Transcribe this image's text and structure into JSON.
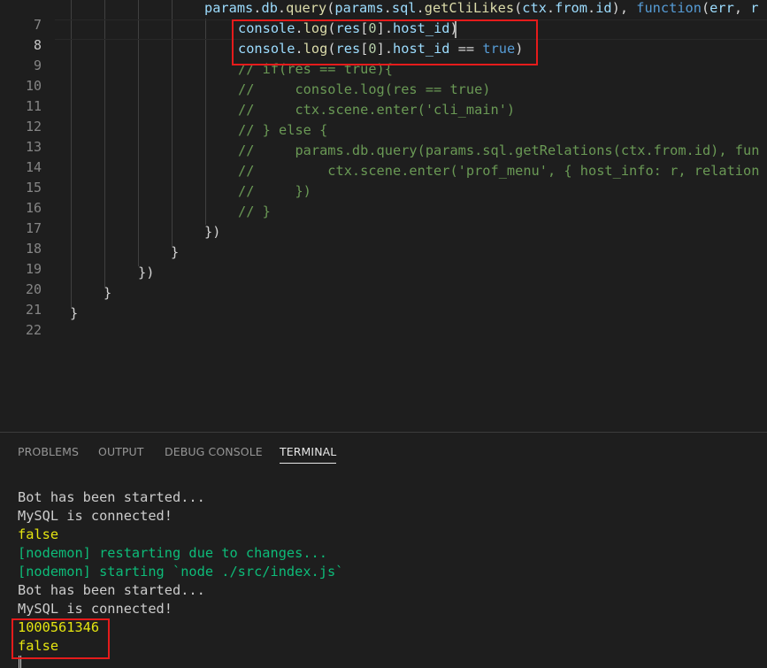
{
  "editor": {
    "lines": [
      {
        "num": "7",
        "text": "params.db.query(params.sql.getCliLikes(ctx.from.id), function(err, r"
      },
      {
        "num": "8",
        "text": "console.log(res[0].host_id)"
      },
      {
        "num": "9",
        "text": "console.log(res[0].host_id == true)"
      },
      {
        "num": "10",
        "text": "// if(res == true){"
      },
      {
        "num": "11",
        "text": "//     console.log(res == true)"
      },
      {
        "num": "12",
        "text": "//     ctx.scene.enter('cli_main')"
      },
      {
        "num": "13",
        "text": "// } else {"
      },
      {
        "num": "14",
        "text": "//     params.db.query(params.sql.getRelations(ctx.from.id), fun"
      },
      {
        "num": "15",
        "text": "//         ctx.scene.enter('prof_menu', { host_info: r, relation"
      },
      {
        "num": "16",
        "text": "//     })"
      },
      {
        "num": "17",
        "text": "// }"
      },
      {
        "num": "18",
        "text": "})"
      },
      {
        "num": "19",
        "text": "}"
      },
      {
        "num": "20",
        "text": "})"
      },
      {
        "num": "21",
        "text": "}"
      },
      {
        "num": "22",
        "text": "}"
      }
    ]
  },
  "panel": {
    "tabs": [
      {
        "label": "PROBLEMS"
      },
      {
        "label": "OUTPUT"
      },
      {
        "label": "DEBUG CONSOLE"
      },
      {
        "label": "TERMINAL",
        "active": true
      }
    ],
    "terminal": [
      {
        "text": "Bot has been started...",
        "color": "default"
      },
      {
        "text": "MySQL is connected!",
        "color": "default"
      },
      {
        "text": "false",
        "color": "yellow"
      },
      {
        "text": "[nodemon] restarting due to changes...",
        "color": "green"
      },
      {
        "text": "[nodemon] starting `node ./src/index.js`",
        "color": "green"
      },
      {
        "text": "Bot has been started...",
        "color": "default"
      },
      {
        "text": "MySQL is connected!",
        "color": "default"
      },
      {
        "text": "1000561346",
        "color": "yellow"
      },
      {
        "text": "false",
        "color": "yellow"
      }
    ]
  },
  "theme": {
    "background": "#1e1e1e",
    "highlight": "#e51b1b",
    "keyword": "#569cd6",
    "function": "#dcdcaa",
    "variable": "#9cdcfe",
    "number": "#b5cea8",
    "string": "#ce9178",
    "comment": "#6a9955",
    "terminal_yellow": "#e5e510",
    "terminal_green": "#0dbc79"
  }
}
